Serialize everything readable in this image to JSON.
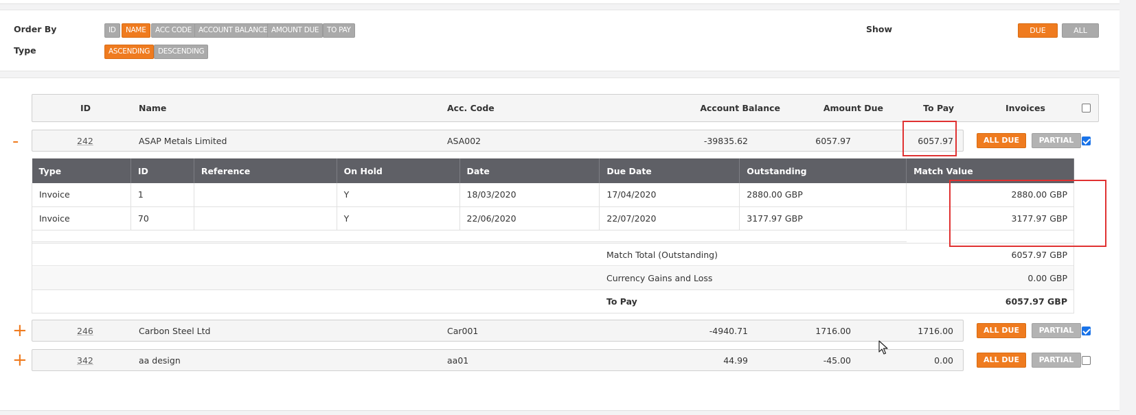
{
  "filters": {
    "order_by_label": "Order By",
    "type_label": "Type",
    "show_label": "Show",
    "order_by_options": [
      "ID",
      "NAME",
      "ACC CODE",
      "ACCOUNT BALANCE",
      "AMOUNT DUE",
      "TO PAY"
    ],
    "order_by_selected": "NAME",
    "type_options": [
      "ASCENDING",
      "DESCENDING"
    ],
    "type_selected": "ASCENDING",
    "show_options": [
      "DUE",
      "ALL"
    ],
    "show_selected": "DUE"
  },
  "table": {
    "headers": {
      "id": "ID",
      "name": "Name",
      "acc_code": "Acc. Code",
      "account_balance": "Account Balance",
      "amount_due": "Amount Due",
      "to_pay": "To Pay",
      "invoices": "Invoices"
    },
    "select_all_checked": false,
    "rows": [
      {
        "toggle": "-",
        "id": "242",
        "name": "ASAP Metals Limited",
        "acc_code": "ASA002",
        "account_balance": "-39835.62",
        "amount_due": "6057.97",
        "to_pay": "6057.97",
        "all_due_label": "ALL DUE",
        "partial_label": "PARTIAL",
        "checked": true
      },
      {
        "toggle": "+",
        "id": "246",
        "name": "Carbon Steel Ltd",
        "acc_code": "Car001",
        "account_balance": "-4940.71",
        "amount_due": "1716.00",
        "to_pay": "1716.00",
        "all_due_label": "ALL DUE",
        "partial_label": "PARTIAL",
        "checked": true
      },
      {
        "toggle": "+",
        "id": "342",
        "name": "aa design",
        "acc_code": "aa01",
        "account_balance": "44.99",
        "amount_due": "-45.00",
        "to_pay": "0.00",
        "all_due_label": "ALL DUE",
        "partial_label": "PARTIAL",
        "checked": false
      }
    ]
  },
  "invoice_detail": {
    "headers": [
      "Type",
      "ID",
      "Reference",
      "On Hold",
      "Date",
      "Due Date",
      "Outstanding",
      "Match Value"
    ],
    "rows": [
      {
        "type": "Invoice",
        "id": "1",
        "reference": "",
        "on_hold": "Y",
        "date": "18/03/2020",
        "due_date": "17/04/2020",
        "outstanding": "2880.00 GBP",
        "match_value": "2880.00 GBP"
      },
      {
        "type": "Invoice",
        "id": "70",
        "reference": "",
        "on_hold": "Y",
        "date": "22/06/2020",
        "due_date": "22/07/2020",
        "outstanding": "3177.97 GBP",
        "match_value": "3177.97 GBP"
      }
    ],
    "summary": {
      "match_total_label": "Match Total (Outstanding)",
      "match_total_value": "6057.97 GBP",
      "currency_label": "Currency Gains and Loss",
      "currency_value": "0.00 GBP",
      "to_pay_label": "To Pay",
      "to_pay_value": "6057.97 GBP"
    }
  },
  "colors": {
    "accent": "#ef7b1f",
    "inactive_button": "#aaaaaa",
    "table_header": "#5f6066",
    "highlight_box": "#e03131",
    "checkbox": "#1a73e8"
  }
}
